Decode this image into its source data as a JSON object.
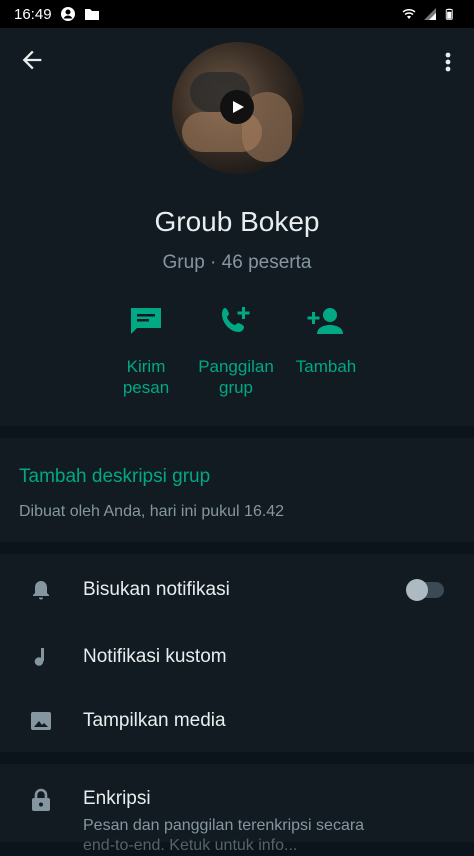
{
  "status_bar": {
    "time": "16:49"
  },
  "group": {
    "name": "Groub Bokep",
    "subtitle": "Grup · 46 peserta"
  },
  "actions": [
    {
      "label_line1": "Kirim",
      "label_line2": "pesan",
      "icon": "message-icon"
    },
    {
      "label_line1": "Panggilan",
      "label_line2": "grup",
      "icon": "add-call-icon"
    },
    {
      "label_line1": "Tambah",
      "label_line2": "",
      "icon": "add-person-icon"
    }
  ],
  "description": {
    "add_link": "Tambah deskripsi grup",
    "created_text": "Dibuat oleh Anda, hari ini pukul 16.42"
  },
  "settings": [
    {
      "label": "Bisukan notifikasi",
      "icon": "bell-icon",
      "toggle": false
    },
    {
      "label": "Notifikasi kustom",
      "icon": "music-note-icon"
    },
    {
      "label": "Tampilkan media",
      "icon": "image-icon"
    }
  ],
  "encryption": {
    "title": "Enkripsi",
    "desc_line1": "Pesan dan panggilan terenkripsi secara",
    "desc_line2": "end-to-end. Ketuk untuk info..."
  },
  "colors": {
    "accent": "#00a884",
    "background": "#0b141a",
    "panel": "#111b21",
    "secondary_text": "#8696a0"
  }
}
